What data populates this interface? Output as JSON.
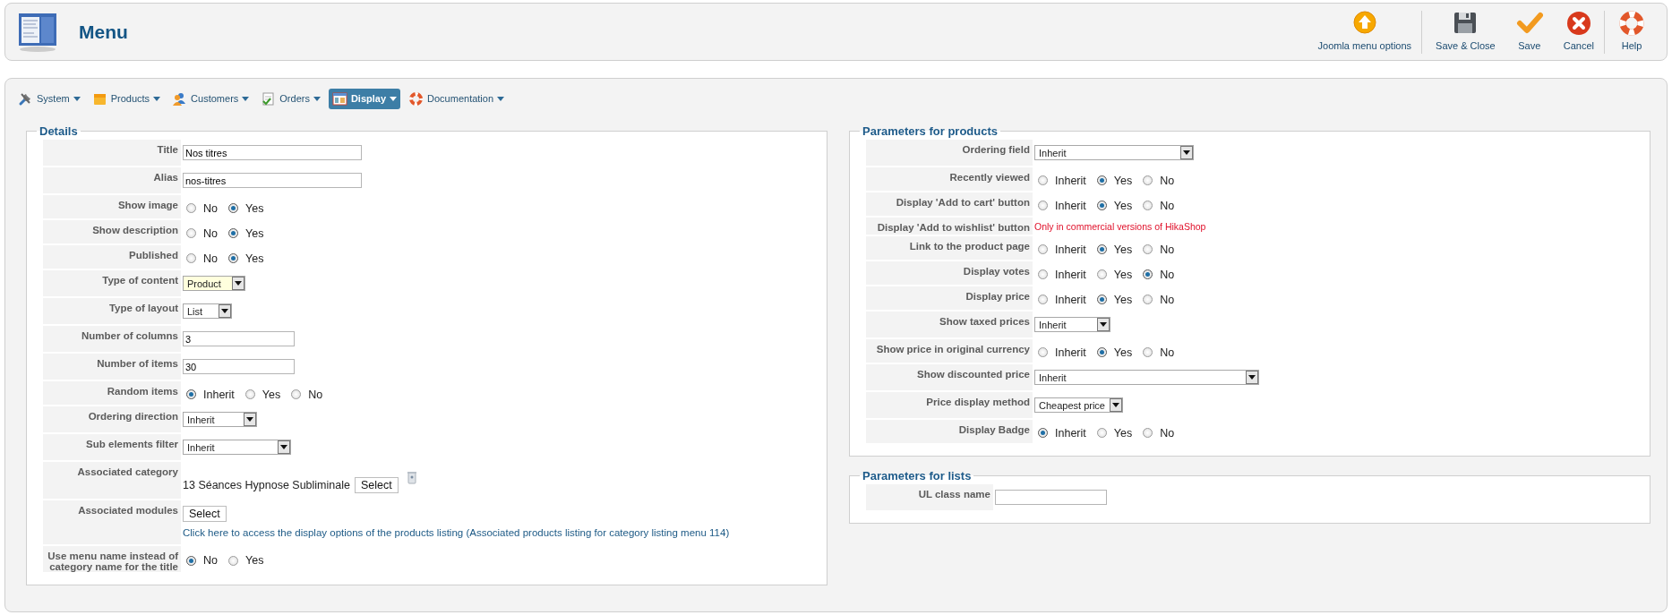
{
  "header": {
    "title": "Menu",
    "toolbar": [
      {
        "label": "Joomla menu options",
        "kind": "options",
        "separator_after": true
      },
      {
        "label": "Save & Close",
        "kind": "save-close",
        "separator_after": false
      },
      {
        "label": "Save",
        "kind": "save",
        "separator_after": false
      },
      {
        "label": "Cancel",
        "kind": "cancel",
        "separator_after": true
      },
      {
        "label": "Help",
        "kind": "help",
        "separator_after": false
      }
    ]
  },
  "nav": [
    {
      "label": "System",
      "kind": "system",
      "selected": false
    },
    {
      "label": "Products",
      "kind": "products",
      "selected": false
    },
    {
      "label": "Customers",
      "kind": "customers",
      "selected": false
    },
    {
      "label": "Orders",
      "kind": "orders",
      "selected": false
    },
    {
      "label": "Display",
      "kind": "display",
      "selected": true
    },
    {
      "label": "Documentation",
      "kind": "documentation",
      "selected": false
    }
  ],
  "details": {
    "legend": "Details",
    "rows": [
      {
        "label": "Title",
        "kind": "text",
        "value": "Nos titres"
      },
      {
        "label": "Alias",
        "kind": "text",
        "value": "nos-titres"
      },
      {
        "label": "Show image",
        "kind": "radio",
        "options": [
          {
            "label": "No",
            "selected": false
          },
          {
            "label": "Yes",
            "selected": true
          }
        ]
      },
      {
        "label": "Show description",
        "kind": "radio",
        "options": [
          {
            "label": "No",
            "selected": false
          },
          {
            "label": "Yes",
            "selected": true
          }
        ]
      },
      {
        "label": "Published",
        "kind": "radio",
        "options": [
          {
            "label": "No",
            "selected": false
          },
          {
            "label": "Yes",
            "selected": true
          }
        ]
      },
      {
        "label": "Type of content",
        "kind": "select",
        "value": "Product",
        "highlighted": true
      },
      {
        "label": "Type of layout",
        "kind": "select",
        "value": "List",
        "highlighted": false
      },
      {
        "label": "Number of columns",
        "kind": "text",
        "value": "3"
      },
      {
        "label": "Number of items",
        "kind": "text",
        "value": "30"
      },
      {
        "label": "Random items",
        "kind": "radio",
        "options": [
          {
            "label": "Inherit",
            "selected": true
          },
          {
            "label": "Yes",
            "selected": false
          },
          {
            "label": "No",
            "selected": false
          }
        ]
      },
      {
        "label": "Ordering direction",
        "kind": "select",
        "value": "Inherit",
        "highlighted": false
      },
      {
        "label": "Sub elements filter",
        "kind": "select",
        "value": "Inherit",
        "highlighted": false
      },
      {
        "label": "Associated category",
        "kind": "category",
        "value": "13 Séances Hypnose Subliminale",
        "button": "Select"
      },
      {
        "label": "Associated modules",
        "kind": "modules",
        "button": "Select",
        "link": "Click here to access the display options of the products listing (Associated products listing for category listing menu 114)"
      },
      {
        "label": "Use menu name instead of category name for the title",
        "kind": "radio",
        "options": [
          {
            "label": "No",
            "selected": true
          },
          {
            "label": "Yes",
            "selected": false
          }
        ]
      }
    ]
  },
  "product_parameters": {
    "legend": "Parameters for products",
    "rows": [
      {
        "label": "Ordering field",
        "kind": "select",
        "value": "Inherit",
        "highlighted": false
      },
      {
        "label": "Recently viewed",
        "kind": "radio",
        "options": [
          {
            "label": "Inherit",
            "selected": false
          },
          {
            "label": "Yes",
            "selected": true
          },
          {
            "label": "No",
            "selected": false
          }
        ]
      },
      {
        "label": "Display 'Add to cart' button",
        "kind": "radio",
        "options": [
          {
            "label": "Inherit",
            "selected": false
          },
          {
            "label": "Yes",
            "selected": true
          },
          {
            "label": "No",
            "selected": false
          }
        ]
      },
      {
        "label": "Display 'Add to wishlist' button",
        "kind": "note",
        "note": "Only in commercial versions of HikaShop"
      },
      {
        "label": "Link to the product page",
        "kind": "radio",
        "options": [
          {
            "label": "Inherit",
            "selected": false
          },
          {
            "label": "Yes",
            "selected": true
          },
          {
            "label": "No",
            "selected": false
          }
        ]
      },
      {
        "label": "Display votes",
        "kind": "radio",
        "options": [
          {
            "label": "Inherit",
            "selected": false
          },
          {
            "label": "Yes",
            "selected": false
          },
          {
            "label": "No",
            "selected": true
          }
        ]
      },
      {
        "label": "Display price",
        "kind": "radio",
        "options": [
          {
            "label": "Inherit",
            "selected": false
          },
          {
            "label": "Yes",
            "selected": true
          },
          {
            "label": "No",
            "selected": false
          }
        ]
      },
      {
        "label": "Show taxed prices",
        "kind": "select",
        "value": "Inherit",
        "highlighted": false
      },
      {
        "label": "Show price in original currency",
        "kind": "radio",
        "options": [
          {
            "label": "Inherit",
            "selected": false
          },
          {
            "label": "Yes",
            "selected": true
          },
          {
            "label": "No",
            "selected": false
          }
        ]
      },
      {
        "label": "Show discounted price",
        "kind": "select",
        "value": "Inherit",
        "highlighted": false
      },
      {
        "label": "Price display method",
        "kind": "select",
        "value": "Cheapest price",
        "highlighted": false
      },
      {
        "label": "Display Badge",
        "kind": "radio",
        "options": [
          {
            "label": "Inherit",
            "selected": true
          },
          {
            "label": "Yes",
            "selected": false
          },
          {
            "label": "No",
            "selected": false
          }
        ]
      }
    ]
  },
  "list_parameters": {
    "legend": "Parameters for lists",
    "rows": [
      {
        "label": "UL class name",
        "kind": "text"
      }
    ]
  }
}
